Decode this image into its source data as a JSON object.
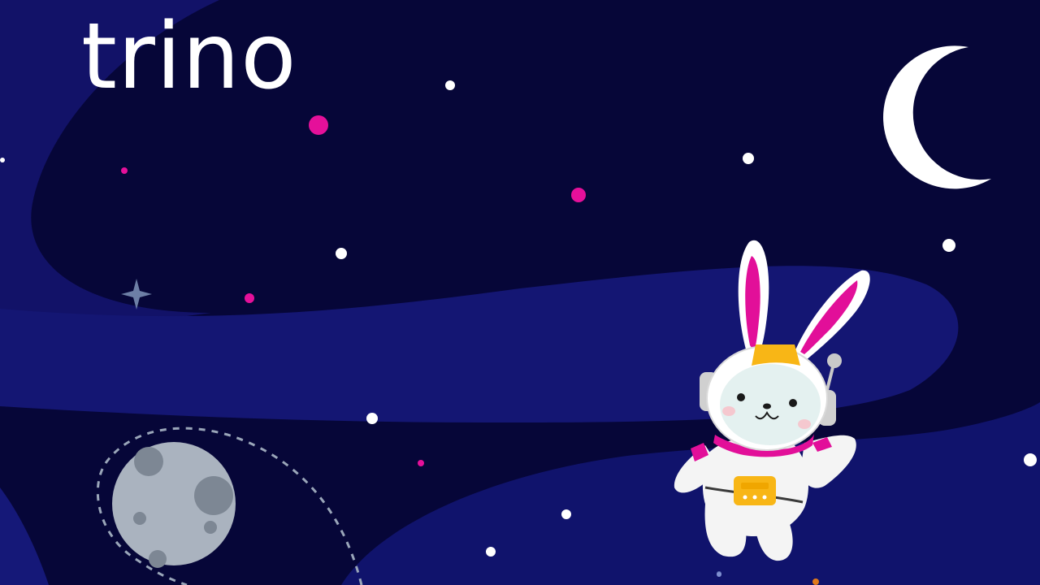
{
  "brand": {
    "logo_text": "trino",
    "logo_color": "#ffffff"
  },
  "palette": {
    "space_dark": "#060638",
    "nebula": "#111266",
    "star_white": "#ffffff",
    "star_pink": "#e5109a",
    "planet_gray": "#aab3bf",
    "crater_gray": "#7d8794",
    "suit_white": "#f4f4f4",
    "ear_magenta": "#e20f99",
    "helmet_band_yellow": "#f8b616",
    "visor_mint": "#e4f1f0"
  },
  "illustration": {
    "mascot": "astronaut-bunny",
    "moon_shape": "crescent",
    "planet": "cratered-planet-with-dotted-orbit"
  }
}
